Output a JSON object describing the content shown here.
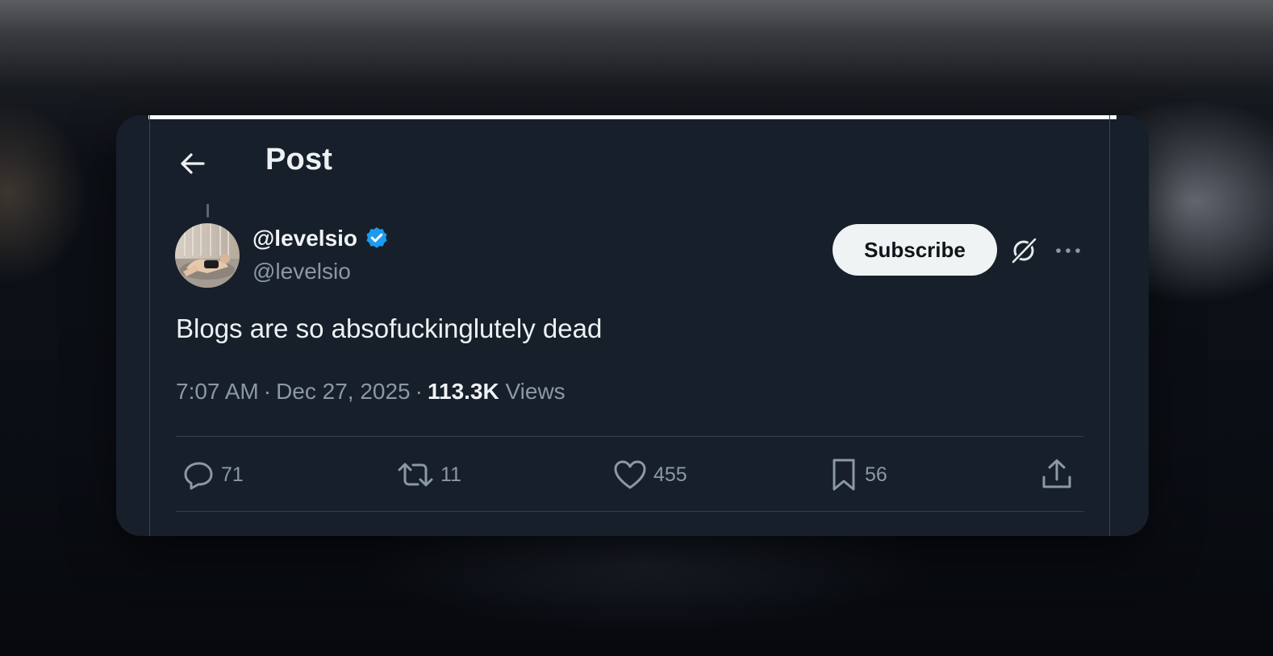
{
  "header": {
    "title": "Post",
    "back_icon": "arrow-left-icon"
  },
  "author": {
    "display_name": "@levelsio",
    "handle": "@levelsio",
    "verified": true,
    "verified_color": "#1d9bf0"
  },
  "actions_top": {
    "subscribe_label": "Subscribe",
    "grok_icon": "grok-icon",
    "more_icon": "more-horizontal-icon"
  },
  "tweet": {
    "text": "Blogs are so absofuckinglutely dead",
    "time": "7:07 AM",
    "date": "Dec 27, 2025",
    "separator": "·",
    "views_count": "113.3K",
    "views_label": "Views"
  },
  "engagement": {
    "replies": "71",
    "reposts": "11",
    "likes": "455",
    "bookmarks": "56"
  },
  "colors": {
    "card_bg": "#161f2a",
    "text_primary": "#eef1f4",
    "text_secondary": "#8b98a5",
    "subscribe_bg": "#eff3f4"
  }
}
